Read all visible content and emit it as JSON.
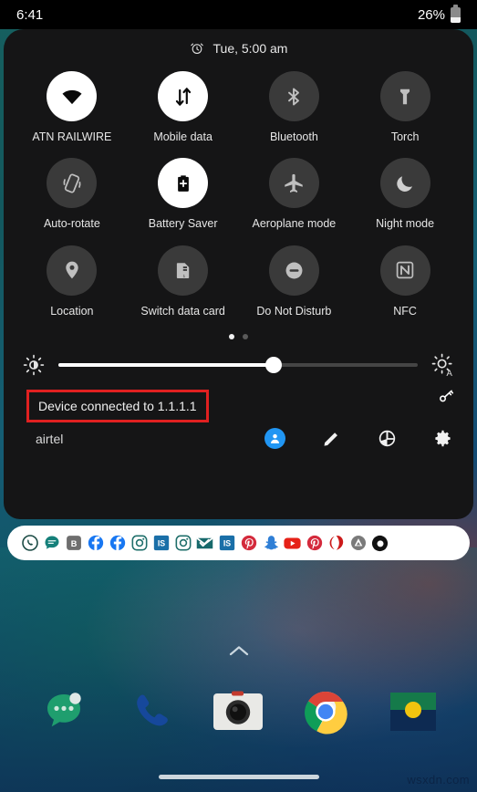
{
  "status_bar": {
    "time": "6:41",
    "battery_percent": "26%",
    "battery_icon": "battery-low-icon"
  },
  "quick_settings": {
    "clock_icon": "alarm-icon",
    "alarm_text": "Tue, 5:00 am",
    "tiles": [
      {
        "label": "ATN RAILWIRE",
        "icon": "wifi-icon",
        "active": true
      },
      {
        "label": "Mobile data",
        "icon": "mobile-data-icon",
        "active": true
      },
      {
        "label": "Bluetooth",
        "icon": "bluetooth-icon",
        "active": false
      },
      {
        "label": "Torch",
        "icon": "flashlight-icon",
        "active": false
      },
      {
        "label": "Auto-rotate",
        "icon": "auto-rotate-icon",
        "active": false
      },
      {
        "label": "Battery Saver",
        "icon": "battery-saver-icon",
        "active": true
      },
      {
        "label": "Aeroplane mode",
        "icon": "airplane-icon",
        "active": false
      },
      {
        "label": "Night mode",
        "icon": "moon-icon",
        "active": false
      },
      {
        "label": "Location",
        "icon": "location-pin-icon",
        "active": false
      },
      {
        "label": "Switch data card",
        "icon": "sim-card-icon",
        "active": false
      },
      {
        "label": "Do Not Disturb",
        "icon": "do-not-disturb-icon",
        "active": false
      },
      {
        "label": "NFC",
        "icon": "nfc-icon",
        "active": false
      }
    ],
    "pages": {
      "count": 2,
      "active_index": 0
    },
    "brightness": {
      "value_percent": 60,
      "low_icon": "brightness-low-icon",
      "auto_icon": "brightness-auto-icon"
    },
    "footer": {
      "device_status": "Device connected to 1.1.1.1",
      "carrier": "airtel",
      "vpn_icon": "vpn-key-icon",
      "icons": [
        {
          "name": "user-avatar-icon",
          "glyph": "person"
        },
        {
          "name": "edit-pencil-icon",
          "glyph": "pencil"
        },
        {
          "name": "power-icon",
          "glyph": "power"
        },
        {
          "name": "settings-gear-icon",
          "glyph": "gear"
        }
      ]
    },
    "highlight_color": "#e02020"
  },
  "app_pill": {
    "apps": [
      {
        "name": "whatsapp-icon",
        "color": "#1a4a44"
      },
      {
        "name": "chat-bubble-icon",
        "color": "#15807a"
      },
      {
        "name": "bing-b-icon",
        "color": "#6e6e6e"
      },
      {
        "name": "facebook-icon-1",
        "color": "#1877f2"
      },
      {
        "name": "facebook-icon-2",
        "color": "#1877f2"
      },
      {
        "name": "instagram-icon-1",
        "color": "#1f6f6b"
      },
      {
        "name": "is-app-icon-1",
        "color": "#1a6fa8"
      },
      {
        "name": "instagram-icon-2",
        "color": "#1f6f6b"
      },
      {
        "name": "mail-check-icon",
        "color": "#17696b"
      },
      {
        "name": "is-app-icon-2",
        "color": "#1a6fa8"
      },
      {
        "name": "pinterest-icon-1",
        "color": "#d42a3c"
      },
      {
        "name": "snapchat-icon",
        "color": "#2f7fd6"
      },
      {
        "name": "youtube-icon",
        "color": "#e62117"
      },
      {
        "name": "pinterest-icon-2",
        "color": "#d42a3c"
      },
      {
        "name": "opera-swirl-icon",
        "color": "#cc1a1a"
      },
      {
        "name": "appbrain-icon",
        "color": "#7a7a7a"
      },
      {
        "name": "ring-app-icon",
        "color": "#111111"
      }
    ]
  },
  "home_screen": {
    "drawer_chevron_icon": "chevron-up-icon",
    "dock_apps": [
      {
        "name": "messages-app-icon"
      },
      {
        "name": "phone-app-icon"
      },
      {
        "name": "camera-app-icon"
      },
      {
        "name": "chrome-app-icon"
      },
      {
        "name": "gallery-app-icon"
      }
    ],
    "home_gesture_bar": "home-indicator",
    "watermark": "wsxdn.com"
  }
}
